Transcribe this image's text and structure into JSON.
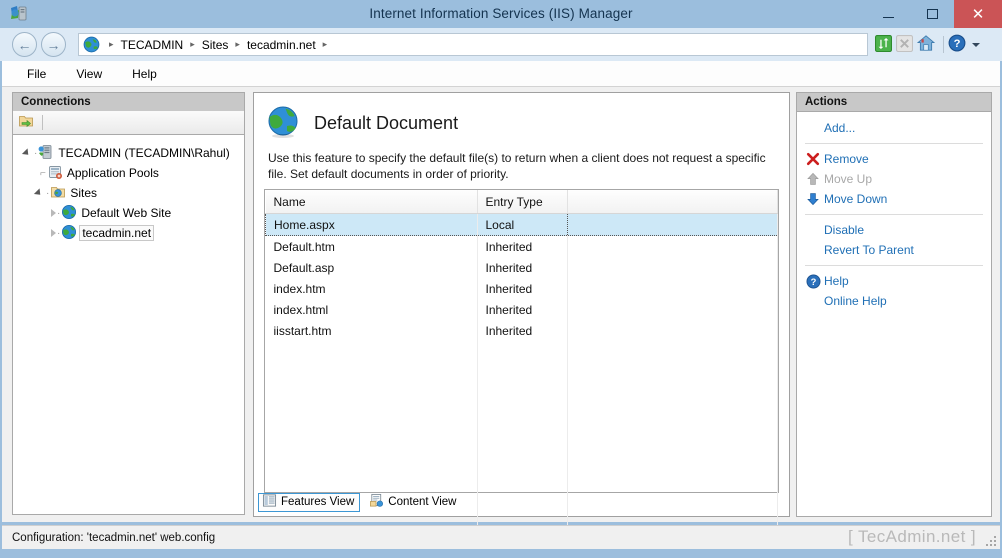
{
  "window": {
    "title": "Internet Information Services (IIS) Manager",
    "icon": "iis-manager-icon",
    "minimize_label": "",
    "maximize_label": "",
    "close_label": "✕"
  },
  "addressbar": {
    "back_label": "←",
    "forward_label": "→",
    "globe_icon": "globe-icon",
    "crumbs": [
      "TECADMIN",
      "Sites",
      "tecadmin.net"
    ],
    "separator": "▸",
    "icons": [
      "refresh-icon",
      "stop-icon",
      "home-icon",
      "help-icon"
    ]
  },
  "menubar": {
    "items": [
      "File",
      "View",
      "Help"
    ]
  },
  "connections": {
    "header": "Connections",
    "toolbar_icon": "connect-to-server-icon",
    "tree": [
      {
        "label": "TECADMIN (TECADMIN\\Rahul)",
        "icon": "server-icon",
        "expander": "open",
        "depth": 0,
        "selected": false
      },
      {
        "label": "Application Pools",
        "icon": "app-pools-icon",
        "expander": "none",
        "depth": 1,
        "selected": false
      },
      {
        "label": "Sites",
        "icon": "sites-folder-icon",
        "expander": "open",
        "depth": 1,
        "selected": false
      },
      {
        "label": "Default Web Site",
        "icon": "website-globe-icon",
        "expander": "closed",
        "depth": 2,
        "selected": false
      },
      {
        "label": "tecadmin.net",
        "icon": "website-globe-icon",
        "expander": "closed",
        "depth": 2,
        "selected": true
      }
    ]
  },
  "feature": {
    "icon": "default-document-globe-icon",
    "title": "Default Document",
    "description": "Use this feature to specify the default file(s) to return when a client does not request a specific file. Set default documents in order of priority.",
    "columns": [
      "Name",
      "Entry Type"
    ],
    "rows": [
      {
        "name": "Home.aspx",
        "entry_type": "Local",
        "selected": true
      },
      {
        "name": "Default.htm",
        "entry_type": "Inherited",
        "selected": false
      },
      {
        "name": "Default.asp",
        "entry_type": "Inherited",
        "selected": false
      },
      {
        "name": "index.htm",
        "entry_type": "Inherited",
        "selected": false
      },
      {
        "name": "index.html",
        "entry_type": "Inherited",
        "selected": false
      },
      {
        "name": "iisstart.htm",
        "entry_type": "Inherited",
        "selected": false
      }
    ],
    "view_tabs": [
      {
        "label": "Features View",
        "icon": "features-view-icon",
        "active": true
      },
      {
        "label": "Content View",
        "icon": "content-view-icon",
        "active": false
      }
    ]
  },
  "actions": {
    "header": "Actions",
    "items": [
      {
        "label": "Add...",
        "icon": "none",
        "disabled": false
      },
      {
        "label": "Remove",
        "icon": "remove-x-icon",
        "disabled": false
      },
      {
        "label": "Move Up",
        "icon": "move-up-arrow-icon",
        "disabled": true
      },
      {
        "label": "Move Down",
        "icon": "move-down-arrow-icon",
        "disabled": false
      },
      {
        "label": "Disable",
        "icon": "none",
        "disabled": false
      },
      {
        "label": "Revert To Parent",
        "icon": "none",
        "disabled": false
      },
      {
        "label": "Help",
        "icon": "help-question-icon",
        "disabled": false
      },
      {
        "label": "Online Help",
        "icon": "none",
        "disabled": false
      }
    ]
  },
  "statusbar": {
    "text": "Configuration: 'tecadmin.net' web.config",
    "watermark": "[ TecAdmin.net ]"
  },
  "colors": {
    "titlebar": "#9bbedd",
    "close_button": "#cb5456",
    "link": "#1f6fb5",
    "selection": "#cde8f7",
    "pane_header": "#c8c8c8"
  }
}
